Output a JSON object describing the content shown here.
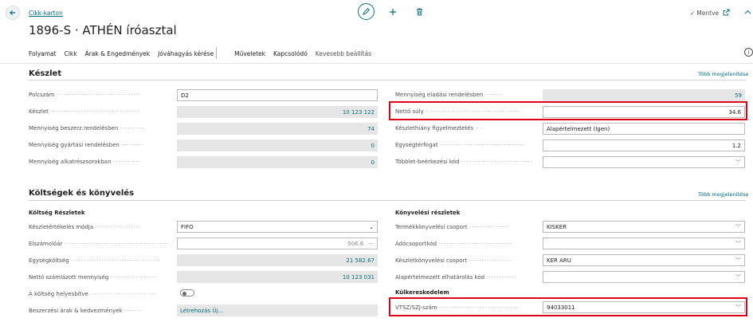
{
  "header": {
    "breadcrumb": "Cikk-karton",
    "title": "1896-S · ATHÉN íróasztal",
    "saved_status": "Mentve"
  },
  "actions": [
    "Folyamat",
    "Cikk",
    "Árak & Engedmények",
    "Jóváhagyás kérése",
    "Műveletek",
    "Kapcsolódó",
    "Kevesebb beállítás"
  ],
  "inventory": {
    "title": "Készlet",
    "show_more": "Több megjelenítése",
    "left": [
      {
        "label": "Polcszám",
        "value": "D2"
      },
      {
        "label": "Készlet",
        "value": "10 123 122"
      },
      {
        "label": "Mennyiség beszerz.rendelésben",
        "value": "74"
      },
      {
        "label": "Mennyiség gyártási rendelésben",
        "value": "0"
      },
      {
        "label": "Mennyiség alkatrészsorokban",
        "value": "0"
      }
    ],
    "right": [
      {
        "label": "Mennyiség eladási rendelésben",
        "value": "59"
      },
      {
        "label": "Nettó súly",
        "value": "34.6"
      },
      {
        "label": "Készlethiány figyelmeztetés",
        "value": "Alapértelmezett (Igen)"
      },
      {
        "label": "Egységtérfogat",
        "value": "1.2"
      },
      {
        "label": "Többlet-beérkezési kód",
        "value": ""
      }
    ]
  },
  "costs": {
    "title": "Költségek és könyvelés",
    "show_more": "Több megjelenítése",
    "left_subtitle": "Költség Részletek",
    "left": [
      {
        "label": "Készletértékelés módja",
        "value": "FIFO"
      },
      {
        "label": "Elszámolóár",
        "value": "506.6"
      },
      {
        "label": "Egységköltség",
        "value": "21 582.67"
      },
      {
        "label": "Nettó számlázott mennyiség",
        "value": "10 123 031"
      },
      {
        "label": "A költség helyesbítve",
        "value": ""
      },
      {
        "label": "Beszerzési árak & kedvezmények",
        "value": "Létrehozás Új..."
      }
    ],
    "right_subtitle": "Könyvelési részletek",
    "right": [
      {
        "label": "Termékkönyvelési csoport",
        "value": "KISKER"
      },
      {
        "label": "Adócsoportkód",
        "value": ""
      },
      {
        "label": "Készletkönyvelési csoport",
        "value": "KER ARU"
      },
      {
        "label": "Alapértelmezett elhatárolás kód",
        "value": ""
      }
    ],
    "foreign_trade_subtitle": "Külkereskedelem",
    "foreign_trade": [
      {
        "label": "VTSZ/SZJ-szám",
        "value": "94033011"
      }
    ]
  },
  "colors": {
    "accent": "#00707a",
    "highlight": "#e0001b"
  },
  "icons": [
    "back-arrow-icon",
    "edit-pencil-icon",
    "plus-icon",
    "delete-icon",
    "checkmark-icon",
    "popout-icon",
    "chevron-down-icon",
    "ellipsis-icon",
    "info-icon"
  ]
}
